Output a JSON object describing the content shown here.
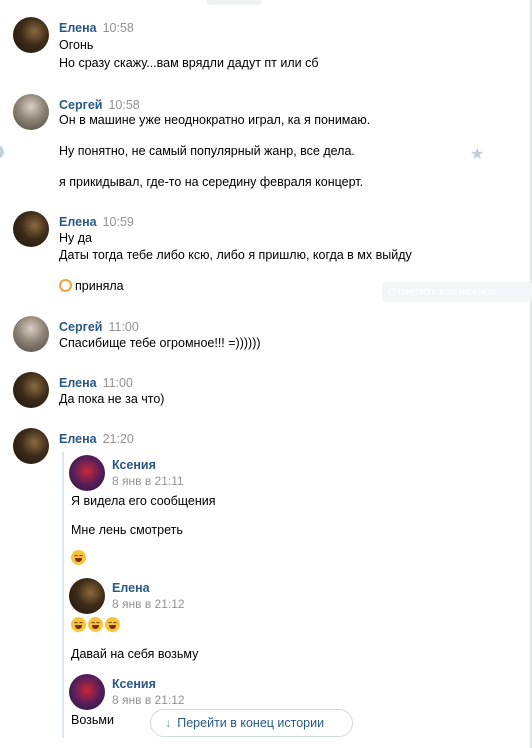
{
  "messages": [
    {
      "author": "Елена",
      "time": "10:58",
      "lines": [
        "Огонь",
        "Но сразу скажу...вам врядли дадут пт или сб"
      ]
    },
    {
      "author": "Сергей",
      "time": "10:58",
      "lines": [
        "Он в машине уже неоднократно играл, ка я понимаю.",
        "Ну понятно, не самый популярный жанр, все дела.",
        "я прикидывал, где-то на середину февраля концерт."
      ]
    },
    {
      "author": "Елена",
      "time": "10:59",
      "lines": [
        "Ну да",
        "Даты тогда тебе либо ксю, либо я пришлю, когда в мх выйду",
        "приняла"
      ]
    },
    {
      "author": "Сергей",
      "time": "11:00",
      "lines": [
        "Спасибище тебе огромное!!! =))))))"
      ]
    },
    {
      "author": "Елена",
      "time": "11:00",
      "lines": [
        "Да пока не за что)"
      ]
    },
    {
      "author": "Елена",
      "time": "21:20",
      "lines": []
    }
  ],
  "forwarded": [
    {
      "author": "Ксения",
      "date": "8 янв в 21:11",
      "lines": [
        "Я видела его сообщения",
        "Мне лень смотреть"
      ]
    },
    {
      "author": "Елена",
      "date": "8 янв в 21:12",
      "lines": [
        "Давай на себя возьму"
      ]
    },
    {
      "author": "Ксения",
      "date": "8 янв в 21:12",
      "lines": [
        "Возьми"
      ]
    }
  ],
  "tooltip": "Отметить как важное",
  "jump_button": "Перейти в конец истории",
  "colors": {
    "author": "#2a5885",
    "time": "#939393",
    "accent": "#2a5885"
  }
}
